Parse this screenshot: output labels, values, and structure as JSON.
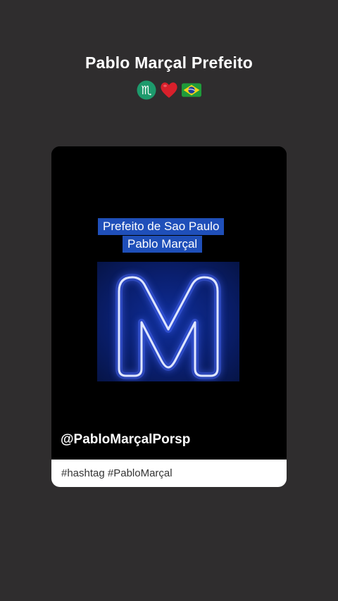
{
  "post": {
    "title": "Pablo Marçal Prefeito",
    "emojis": [
      "scorpio-icon",
      "red-heart-icon",
      "brazil-flag-icon"
    ]
  },
  "card": {
    "caption_line1": "Prefeito de Sao Paulo",
    "caption_line2": "Pablo Marçal",
    "neon_letter": "M",
    "handle": "@PabloMarçalPorsp",
    "hashtags": "#hashtag #PabloMarçal"
  },
  "colors": {
    "background": "#2f2d2e",
    "caption_bg": "#1f4fb9",
    "neon": "#4a6bff"
  }
}
